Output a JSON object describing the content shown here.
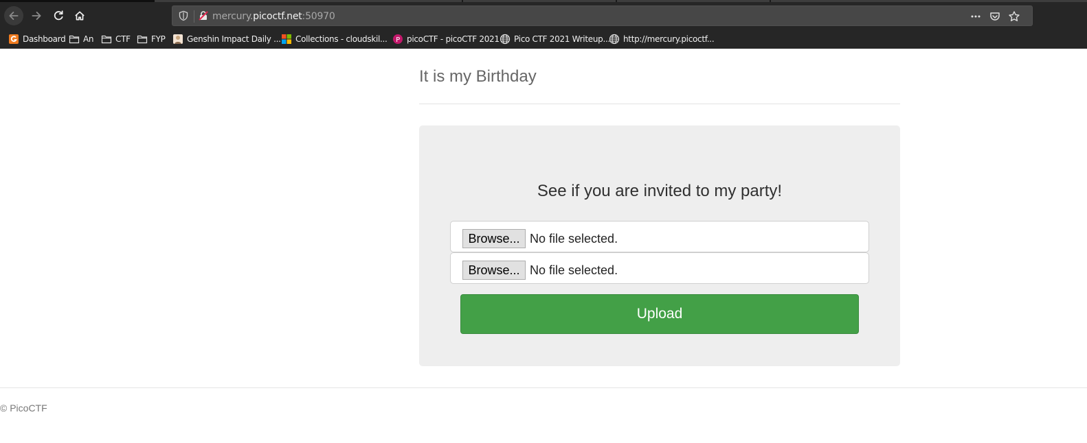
{
  "browser": {
    "url_prefix": "mercury.",
    "url_host": "picoctf.net",
    "url_port": ":50970",
    "bookmarks": [
      {
        "label": "Dashboard",
        "icon": "orange-app-icon"
      },
      {
        "label": "An",
        "icon": "folder-icon"
      },
      {
        "label": "CTF",
        "icon": "folder-icon"
      },
      {
        "label": "FYP",
        "icon": "folder-icon"
      },
      {
        "label": "Genshin Impact Daily ...",
        "icon": "genshin-favicon"
      },
      {
        "label": "Collections - cloudskil...",
        "icon": "microsoft-icon"
      },
      {
        "label": "picoCTF - picoCTF 2021",
        "icon": "picoctf-favicon"
      },
      {
        "label": "Pico CTF 2021 Writeup...",
        "icon": "globe-icon"
      },
      {
        "label": "http://mercury.picoctf...",
        "icon": "globe-icon"
      }
    ]
  },
  "page": {
    "title": "It is my Birthday",
    "heading": "See if you are invited to my party!",
    "file_inputs": [
      {
        "button": "Browse...",
        "status": "No file selected."
      },
      {
        "button": "Browse...",
        "status": "No file selected."
      }
    ],
    "upload_label": "Upload",
    "footer": "© PicoCTF"
  },
  "colors": {
    "upload_button": "#43a047",
    "panel_bg": "#eeeeee",
    "chrome_bg": "#262626"
  }
}
